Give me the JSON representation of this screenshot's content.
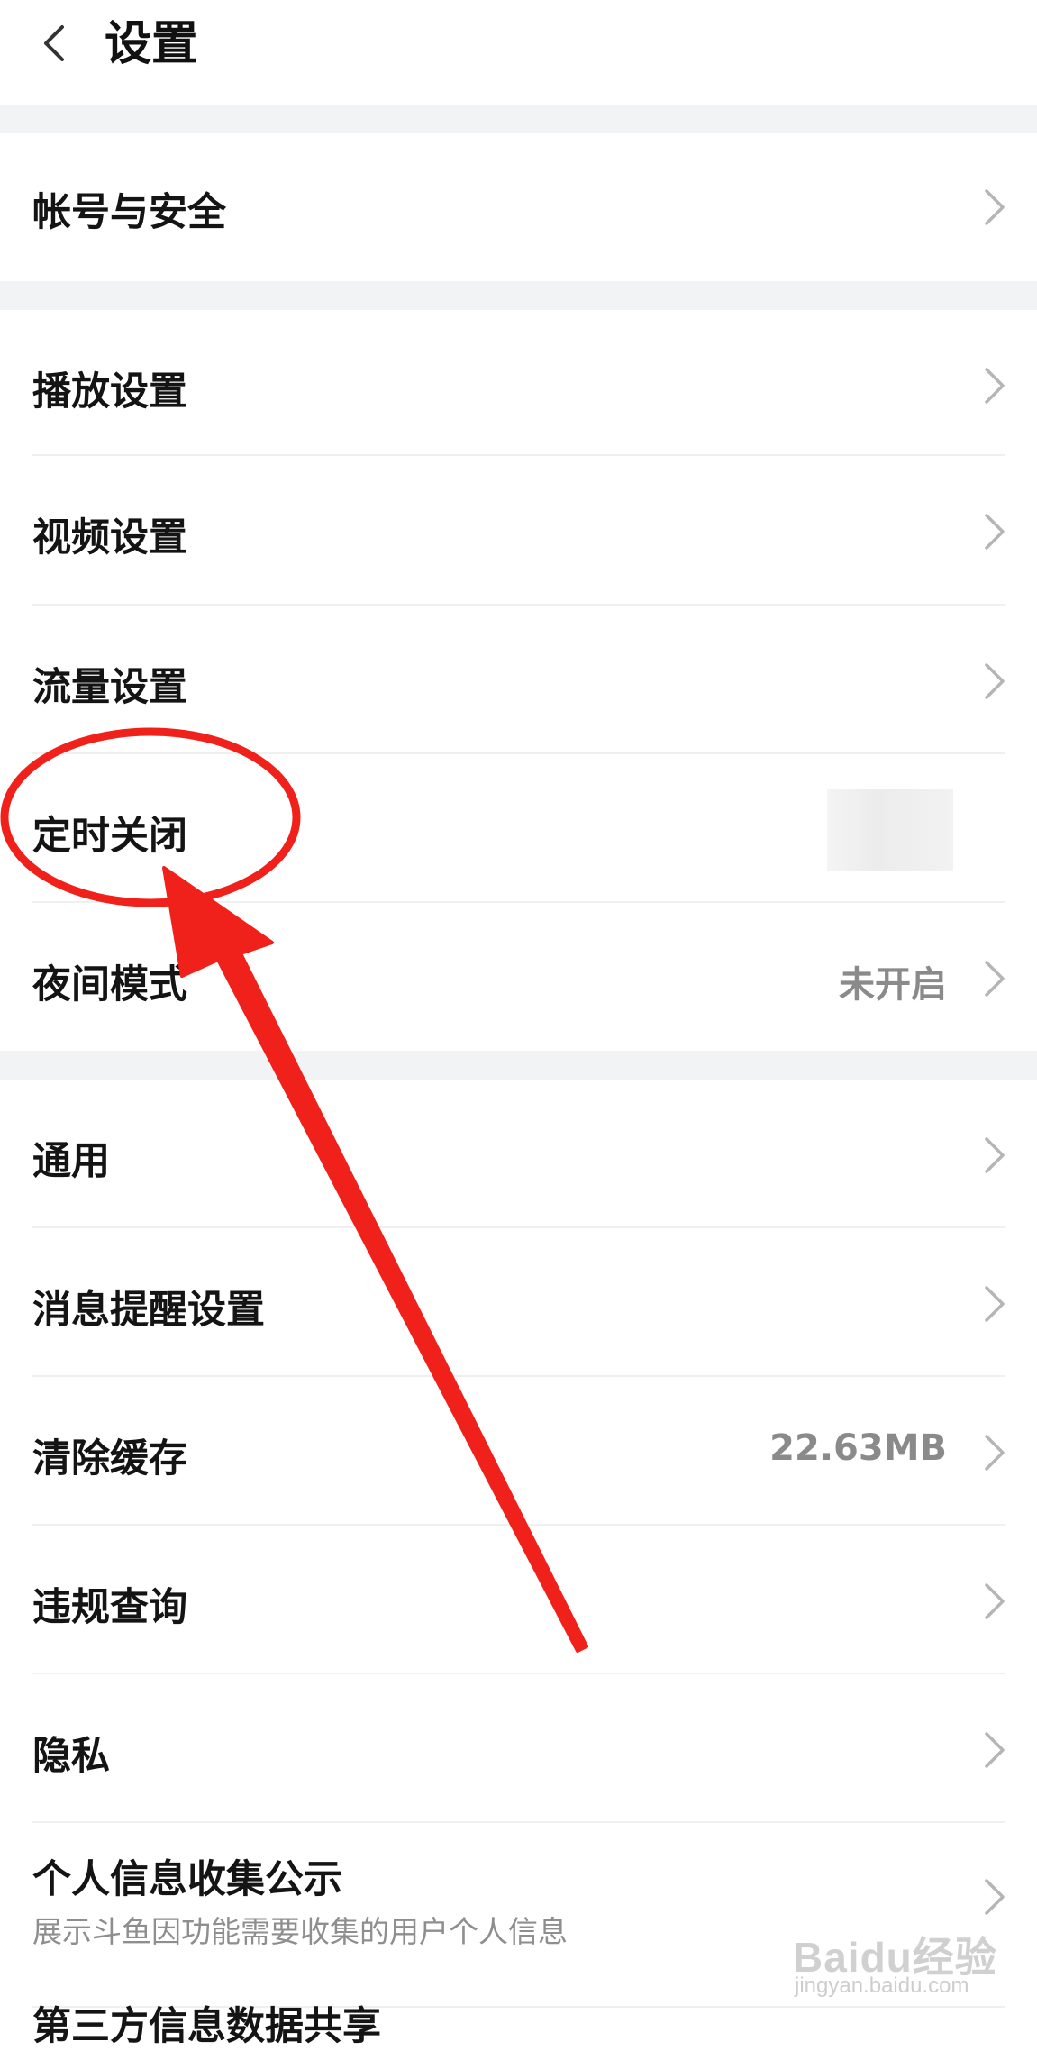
{
  "header": {
    "title": "设置",
    "back_icon": "chevron-left-icon"
  },
  "groups": [
    {
      "items": [
        {
          "label": "帐号与安全"
        }
      ]
    },
    {
      "items": [
        {
          "label": "播放设置"
        },
        {
          "label": "视频设置"
        },
        {
          "label": "流量设置"
        },
        {
          "label": "定时关闭",
          "value": ""
        },
        {
          "label": "夜间模式",
          "value": "未开启"
        }
      ]
    },
    {
      "items": [
        {
          "label": "通用"
        },
        {
          "label": "消息提醒设置"
        },
        {
          "label": "清除缓存",
          "value": "22.63MB"
        },
        {
          "label": "违规查询"
        },
        {
          "label": "隐私"
        },
        {
          "label": "个人信息收集公示",
          "subtitle": "展示斗鱼因功能需要收集的用户个人信息"
        },
        {
          "label": "第三方信息数据共享"
        }
      ]
    }
  ],
  "annotation": {
    "color": "#f0211b",
    "highlight_shape": "ellipse",
    "pointer_shape": "arrow"
  },
  "watermark": {
    "brand": "Baidu经验",
    "url": "jingyan.baidu.com"
  },
  "colors": {
    "background": "#ffffff",
    "section_gap": "#f1f3f4",
    "secondary_text": "#8a8a8a",
    "chevron": "#b5b5b5"
  }
}
